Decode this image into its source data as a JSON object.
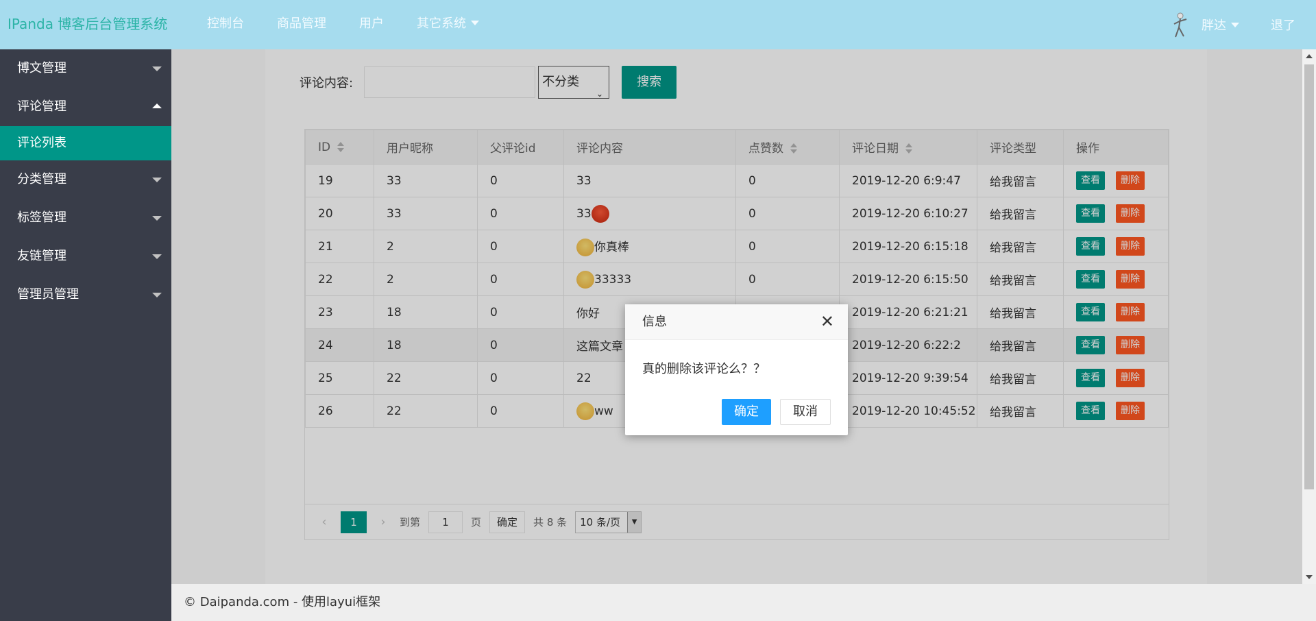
{
  "header": {
    "logo": "IPanda 博客后台管理系统",
    "nav": [
      "控制台",
      "商品管理",
      "用户",
      "其它系统"
    ],
    "user_name": "胖达",
    "logout": "退了"
  },
  "sidebar": {
    "items": [
      {
        "label": "博文管理"
      },
      {
        "label": "评论管理"
      },
      {
        "label": "分类管理"
      },
      {
        "label": "标签管理"
      },
      {
        "label": "友链管理"
      },
      {
        "label": "管理员管理"
      }
    ],
    "active_child": "评论列表"
  },
  "search": {
    "label": "评论内容:",
    "input_value": "",
    "select_value": "不分类",
    "button": "搜索"
  },
  "table": {
    "columns": [
      "ID",
      "用户昵称",
      "父评论id",
      "评论内容",
      "点赞数",
      "评论日期",
      "评论类型",
      "操作"
    ],
    "rows": [
      {
        "id": "19",
        "nick": "33",
        "parent": "0",
        "content": "33",
        "emoji": "",
        "likes": "0",
        "date": "2019-12-20 6:9:47",
        "type": "给我留言"
      },
      {
        "id": "20",
        "nick": "33",
        "parent": "0",
        "content": "33",
        "emoji": "angry-emoji-icon",
        "likes": "0",
        "date": "2019-12-20 6:10:27",
        "type": "给我留言"
      },
      {
        "id": "21",
        "nick": "2",
        "parent": "0",
        "content": "你真棒",
        "emoji": "smile-emoji-icon",
        "likes": "0",
        "date": "2019-12-20 6:15:18",
        "type": "给我留言"
      },
      {
        "id": "22",
        "nick": "2",
        "parent": "0",
        "content": "33333",
        "emoji": "yawn-emoji-icon",
        "likes": "0",
        "date": "2019-12-20 6:15:50",
        "type": "给我留言"
      },
      {
        "id": "23",
        "nick": "18",
        "parent": "0",
        "content": "你好",
        "emoji": "",
        "likes": "",
        "date": "2019-12-20 6:21:21",
        "type": "给我留言"
      },
      {
        "id": "24",
        "nick": "18",
        "parent": "0",
        "content": "这篇文章",
        "emoji": "",
        "likes": "",
        "date": "2019-12-20 6:22:2",
        "type": "给我留言"
      },
      {
        "id": "25",
        "nick": "22",
        "parent": "0",
        "content": "22",
        "emoji": "",
        "likes": "",
        "date": "2019-12-20 9:39:54",
        "type": "给我留言"
      },
      {
        "id": "26",
        "nick": "22",
        "parent": "0",
        "content": "ww",
        "emoji": "laugh-emoji-icon",
        "likes": "",
        "date": "2019-12-20 10:45:52",
        "type": "给我留言"
      }
    ],
    "view_label": "查看",
    "delete_label": "删除"
  },
  "pager": {
    "current": "1",
    "goto_label": "到第",
    "goto_value": "1",
    "page_label": "页",
    "confirm": "确定",
    "total": "共 8 条",
    "per_page": "10 条/页"
  },
  "footer": "© Daipanda.com - 使用layui框架",
  "dialog": {
    "title": "信息",
    "message": "真的删除该评论么？？",
    "ok": "确定",
    "cancel": "取消"
  },
  "colors": {
    "header_bg": "#a6dcee",
    "sidebar_bg": "#393d49",
    "accent": "#009688",
    "danger": "#ff5722",
    "primary": "#1e9fff"
  }
}
